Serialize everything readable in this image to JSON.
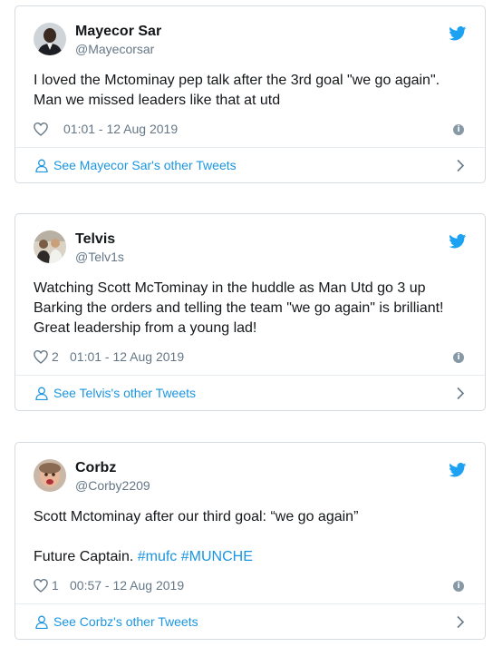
{
  "colors": {
    "accent": "#1b95e0",
    "secondary_text": "#657786",
    "border": "#d6dbe0"
  },
  "tweets": [
    {
      "name": "Mayecor Sar",
      "handle": "@Mayecorsar",
      "avatar_icon": "avatar-photo-man-suit",
      "lines": [
        "I loved the Mctominay pep talk after the 3rd goal \"we go again\".",
        "Man we missed leaders like that at utd"
      ],
      "likes": "",
      "time": "01:01 - 12 Aug 2019",
      "footer": "See Mayecor Sar's other Tweets"
    },
    {
      "name": "Telvis",
      "handle": "@Telv1s",
      "avatar_icon": "avatar-photo-group",
      "lines": [
        "Watching Scott McTominay in the huddle as Man Utd go 3 up",
        "Barking the orders and telling the team \"we go again\" is brilliant!",
        "Great leadership from a young lad!"
      ],
      "likes": "2",
      "time": "01:01 - 12 Aug 2019",
      "footer": "See Telvis's other Tweets"
    },
    {
      "name": "Corbz",
      "handle": "@Corby2209",
      "avatar_icon": "avatar-photo-face",
      "lines": [
        "Scott Mctominay after our third goal: “we go again”",
        "",
        "Future Captain."
      ],
      "hashtags": [
        "#mufc",
        "#MUNCHE"
      ],
      "likes": "1",
      "time": "00:57 - 12 Aug 2019",
      "footer": "See Corbz's other Tweets"
    }
  ]
}
